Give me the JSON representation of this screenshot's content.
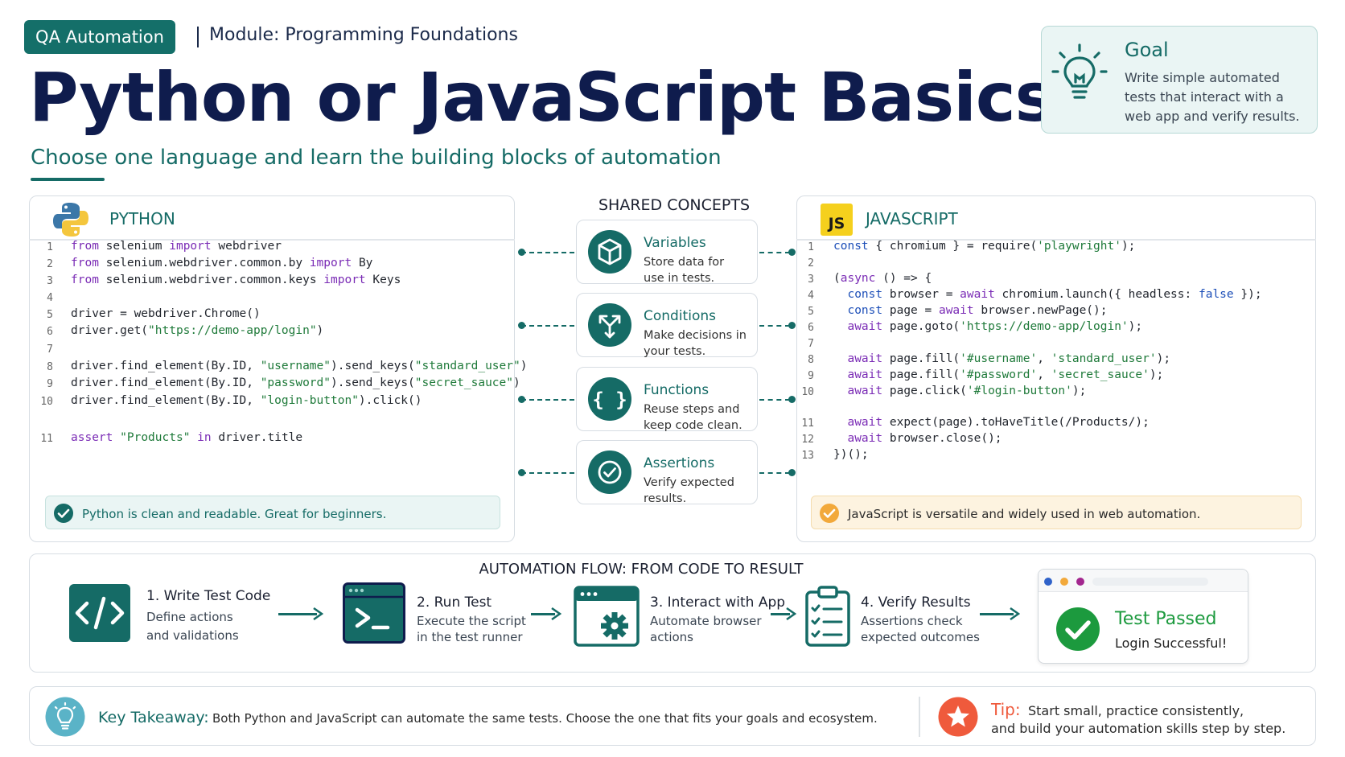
{
  "header": {
    "badge": "QA Automation",
    "module": "Module: Programming Foundations",
    "title": "Python or JavaScript Basics",
    "subtitle": "Choose one  language and learn the building blocks of automation"
  },
  "goal": {
    "title": "Goal",
    "text": "Write simple automated tests that interact with a web app and verify results."
  },
  "python": {
    "title": "PYTHON",
    "lines": [
      {
        "n": "1",
        "parts": [
          {
            "c": "kw",
            "t": "from"
          },
          {
            "c": "",
            "t": " selenium "
          },
          {
            "c": "kw",
            "t": "import"
          },
          {
            "c": "",
            "t": " webdriver"
          }
        ]
      },
      {
        "n": "2",
        "parts": [
          {
            "c": "kw",
            "t": "from"
          },
          {
            "c": "",
            "t": " selenium.webdriver.common.by "
          },
          {
            "c": "kw",
            "t": "import"
          },
          {
            "c": "",
            "t": " By"
          }
        ]
      },
      {
        "n": "3",
        "parts": [
          {
            "c": "kw",
            "t": "from"
          },
          {
            "c": "",
            "t": " selenium.webdriver.common.keys "
          },
          {
            "c": "kw",
            "t": "import"
          },
          {
            "c": "",
            "t": " Keys"
          }
        ]
      },
      {
        "n": "4",
        "parts": []
      },
      {
        "n": "5",
        "parts": [
          {
            "c": "",
            "t": "driver = webdriver.Chrome()"
          }
        ]
      },
      {
        "n": "6",
        "parts": [
          {
            "c": "",
            "t": "driver.get("
          },
          {
            "c": "str",
            "t": "\"https://demo-app/login\""
          },
          {
            "c": "",
            "t": ")"
          }
        ]
      },
      {
        "n": "7",
        "parts": []
      },
      {
        "n": "8",
        "parts": [
          {
            "c": "",
            "t": "driver.find_element(By.ID, "
          },
          {
            "c": "str",
            "t": "\"username\""
          },
          {
            "c": "",
            "t": ").send_keys("
          },
          {
            "c": "str",
            "t": "\"standard_user\""
          },
          {
            "c": "",
            "t": ")"
          }
        ]
      },
      {
        "n": "9",
        "parts": [
          {
            "c": "",
            "t": "driver.find_element(By.ID, "
          },
          {
            "c": "str",
            "t": "\"password\""
          },
          {
            "c": "",
            "t": ").send_keys("
          },
          {
            "c": "str",
            "t": "\"secret_sauce\""
          },
          {
            "c": "",
            "t": ")"
          }
        ]
      },
      {
        "n": "10",
        "parts": [
          {
            "c": "",
            "t": "driver.find_element(By.ID, "
          },
          {
            "c": "str",
            "t": "\"login-button\""
          },
          {
            "c": "",
            "t": ").click()"
          }
        ]
      },
      {
        "n": "11",
        "parts": [
          {
            "c": "kw",
            "t": "assert"
          },
          {
            "c": "",
            "t": " "
          },
          {
            "c": "str",
            "t": "\"Products\""
          },
          {
            "c": "",
            "t": " "
          },
          {
            "c": "kw",
            "t": "in"
          },
          {
            "c": "",
            "t": " driver.title"
          }
        ]
      }
    ],
    "note": "Python is clean and readable. Great for beginners."
  },
  "javascript": {
    "logo": "JS",
    "title": "JAVASCRIPT",
    "lines": [
      {
        "n": "1",
        "parts": [
          {
            "c": "blue",
            "t": "const"
          },
          {
            "c": "",
            "t": " { chromium } = require("
          },
          {
            "c": "str",
            "t": "'playwright'"
          },
          {
            "c": "",
            "t": ");"
          }
        ]
      },
      {
        "n": "2",
        "parts": []
      },
      {
        "n": "3",
        "parts": [
          {
            "c": "",
            "t": "("
          },
          {
            "c": "kw",
            "t": "async"
          },
          {
            "c": "",
            "t": " () => {"
          }
        ]
      },
      {
        "n": "4",
        "parts": [
          {
            "c": "",
            "t": "  "
          },
          {
            "c": "blue",
            "t": "const"
          },
          {
            "c": "",
            "t": " browser = "
          },
          {
            "c": "kw",
            "t": "await"
          },
          {
            "c": "",
            "t": " chromium.launch({ headless: "
          },
          {
            "c": "blue",
            "t": "false"
          },
          {
            "c": "",
            "t": " });"
          }
        ]
      },
      {
        "n": "5",
        "parts": [
          {
            "c": "",
            "t": "  "
          },
          {
            "c": "blue",
            "t": "const"
          },
          {
            "c": "",
            "t": " page = "
          },
          {
            "c": "kw",
            "t": "await"
          },
          {
            "c": "",
            "t": " browser.newPage();"
          }
        ]
      },
      {
        "n": "6",
        "parts": [
          {
            "c": "",
            "t": "  "
          },
          {
            "c": "kw",
            "t": "await"
          },
          {
            "c": "",
            "t": " page.goto("
          },
          {
            "c": "str",
            "t": "'https://demo-app/login'"
          },
          {
            "c": "",
            "t": ");"
          }
        ]
      },
      {
        "n": "7",
        "parts": []
      },
      {
        "n": "8",
        "parts": [
          {
            "c": "",
            "t": "  "
          },
          {
            "c": "kw",
            "t": "await"
          },
          {
            "c": "",
            "t": " page.fill("
          },
          {
            "c": "str",
            "t": "'#username'"
          },
          {
            "c": "",
            "t": ", "
          },
          {
            "c": "str",
            "t": "'standard_user'"
          },
          {
            "c": "",
            "t": ");"
          }
        ]
      },
      {
        "n": "9",
        "parts": [
          {
            "c": "",
            "t": "  "
          },
          {
            "c": "kw",
            "t": "await"
          },
          {
            "c": "",
            "t": " page.fill("
          },
          {
            "c": "str",
            "t": "'#password'"
          },
          {
            "c": "",
            "t": ", "
          },
          {
            "c": "str",
            "t": "'secret_sauce'"
          },
          {
            "c": "",
            "t": ");"
          }
        ]
      },
      {
        "n": "10",
        "parts": [
          {
            "c": "",
            "t": "  "
          },
          {
            "c": "kw",
            "t": "await"
          },
          {
            "c": "",
            "t": " page.click("
          },
          {
            "c": "str",
            "t": "'#login-button'"
          },
          {
            "c": "",
            "t": ");"
          }
        ]
      },
      {
        "n": "11",
        "parts": [
          {
            "c": "",
            "t": "  "
          },
          {
            "c": "kw",
            "t": "await"
          },
          {
            "c": "",
            "t": " expect(page).toHaveTitle(/Products/);"
          }
        ]
      },
      {
        "n": "12",
        "parts": [
          {
            "c": "",
            "t": "  "
          },
          {
            "c": "kw",
            "t": "await"
          },
          {
            "c": "",
            "t": " browser.close();"
          }
        ]
      },
      {
        "n": "13",
        "parts": [
          {
            "c": "",
            "t": "})();"
          }
        ]
      }
    ],
    "note": "JavaScript is versatile and widely used in web automation."
  },
  "shared": {
    "title": "SHARED CONCEPTS",
    "items": [
      {
        "title": "Variables",
        "text": "Store data for use in tests."
      },
      {
        "title": "Conditions",
        "text": "Make decisions in your tests."
      },
      {
        "title": "Functions",
        "text": "Reuse steps and keep code clean."
      },
      {
        "title": "Assertions",
        "text": "Verify expected results."
      }
    ]
  },
  "flow": {
    "title": "AUTOMATION FLOW: FROM CODE TO RESULT",
    "steps": [
      {
        "title": "1. Write Test Code",
        "line1": "Define actions",
        "line2": "and validations"
      },
      {
        "title": "2. Run Test",
        "line1": "Execute the script",
        "line2": "in the test runner"
      },
      {
        "title": "3. Interact with App",
        "line1": "Automate browser",
        "line2": "actions"
      },
      {
        "title": "4. Verify Results",
        "line1": "Assertions check",
        "line2": "expected outcomes"
      }
    ],
    "result_title": "Test Passed",
    "result_text": "Login Successful!"
  },
  "footer": {
    "takeaway_label": "Key Takeaway:",
    "takeaway_text": "Both Python and JavaScript can automate the same tests. Choose the one that fits your goals and ecosystem.",
    "tip_label": "Tip:",
    "tip_line1": "Start small, practice consistently,",
    "tip_line2": "and build your automation skills step by step."
  },
  "colors": {
    "teal": "#156b66",
    "navy": "#0f1c4d",
    "green": "#1c9a3e",
    "orange": "#f2a93b",
    "red": "#ef5a3c"
  }
}
